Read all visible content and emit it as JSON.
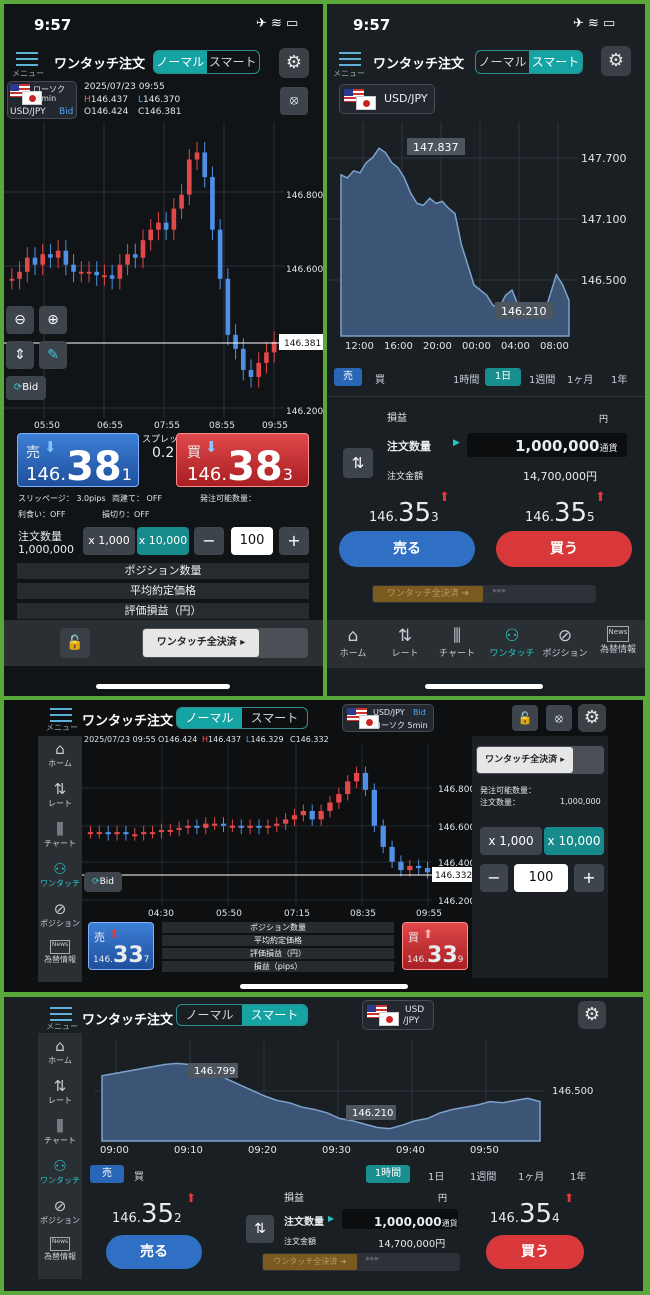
{
  "p1": {
    "time": "9:57",
    "menu_label": "メニュー",
    "title": "ワンタッチ注文",
    "seg_normal": "ノーマル",
    "seg_smart": "スマート",
    "chart_type": "ローソク",
    "interval": "5min",
    "pair": "USD/JPY",
    "side": "Bid",
    "datetime": "2025/07/23 09:55",
    "h_lbl": "H",
    "h_val": "146.437",
    "l_lbl": "L",
    "l_val": "146.370",
    "o_lbl": "O",
    "o_val": "146.424",
    "c_lbl": "C",
    "c_val": "146.381",
    "y_ticks": [
      "146.800",
      "146.600",
      "146.200"
    ],
    "current": "146.381",
    "x_ticks": [
      "05:50",
      "06:55",
      "07:55",
      "08:55",
      "09:55"
    ],
    "bid_btn": "Bid",
    "sell_lbl": "売",
    "buy_lbl": "買",
    "sell_pre": "146.",
    "sell_big": "38",
    "sell_last": "1",
    "buy_pre": "146.",
    "buy_big": "38",
    "buy_last": "3",
    "spread_lbl": "スプレッド",
    "spread_val": "0.2",
    "slip": "スリッページ： 3.0pips",
    "both": "両建て： OFF",
    "avail": "発注可能数量：",
    "take": "利食い：OFF",
    "stop": "損切り：OFF",
    "qty_lbl": "注文数量",
    "qty_val": "1,000,000",
    "x1000": "x 1,000",
    "x10000": "x 10,000",
    "minus": "−",
    "plus": "+",
    "qty_input": "100",
    "rows": [
      "ポジション数量",
      "平均約定価格",
      "評価損益（円）"
    ],
    "settle": "ワンタッチ全決済"
  },
  "p2": {
    "time": "9:57",
    "menu_label": "メニュー",
    "title": "ワンタッチ注文",
    "seg_normal": "ノーマル",
    "seg_smart": "スマート",
    "pair": "USD/JPY",
    "high_lbl": "147.837",
    "low_lbl": "146.210",
    "y_ticks": [
      "147.700",
      "147.100",
      "146.500"
    ],
    "x_ticks": [
      "12:00",
      "16:00",
      "20:00",
      "00:00",
      "04:00",
      "08:00"
    ],
    "sell_tab": "売",
    "buy_tab": "買",
    "tfs": [
      "1時間",
      "1日",
      "1週間",
      "1ヶ月",
      "1年"
    ],
    "pl_lbl": "損益",
    "yen": "円",
    "qty_lbl": "注文数量",
    "qty_val": "1,000,000",
    "qty_unit": "通貨",
    "amount_lbl": "注文金額",
    "amount_val": "14,700,000円",
    "sell_pre": "146.",
    "sell_big": "35",
    "sell_last": "3",
    "buy_pre": "146.",
    "buy_big": "35",
    "buy_last": "5",
    "sell_btn": "売る",
    "buy_btn": "買う",
    "settle": "ワンタッチ全決済",
    "tabs": [
      "ホーム",
      "レート",
      "チャート",
      "ワンタッチ",
      "ポジション",
      "為替情報"
    ],
    "news": "News"
  },
  "p3": {
    "menu_label": "メニュー",
    "title": "ワンタッチ注文",
    "seg_normal": "ノーマル",
    "seg_smart": "スマート",
    "pair": "USD/JPY",
    "side": "Bid",
    "chart_type": "ローソク 5min",
    "datetime": "2025/07/23 09:55",
    "o_lbl": "O",
    "o_val": "146.424",
    "h_lbl": "H",
    "h_val": "146.437",
    "l_lbl": "L",
    "l_val": "146.329",
    "c_lbl": "C",
    "c_val": "146.332",
    "y_ticks": [
      "146.800",
      "146.600",
      "146.400",
      "146.200"
    ],
    "current": "146.332",
    "x_ticks": [
      "04:30",
      "05:50",
      "07:15",
      "08:35",
      "09:55"
    ],
    "bid_btn": "Bid",
    "tabs": [
      "ホーム",
      "レート",
      "チャート",
      "ワンタッチ",
      "ポジション",
      "為替情報"
    ],
    "news": "News",
    "sell_lbl": "売",
    "buy_lbl": "買",
    "sell_pre": "146.",
    "sell_big": "33",
    "sell_last": "7",
    "buy_pre": "146.",
    "buy_big": "33",
    "buy_last": "9",
    "rows": [
      "ポジション数量",
      "平均約定価格",
      "評価損益（円）",
      "損益（pips）"
    ],
    "settle": "ワンタッチ全決済",
    "avail": "発注可能数量：",
    "qty_lbl": "注文数量：",
    "qty_val": "1,000,000",
    "x1000": "x 1,000",
    "x10000": "x 10,000",
    "minus": "−",
    "plus": "+",
    "qty_input": "100",
    "settings": [
      {
        "k": "スリッページ：",
        "v": "3.0pips"
      },
      {
        "k": "両建て：",
        "v": "OFF"
      },
      {
        "k": "利食い：",
        "v": "OFF"
      },
      {
        "k": "損切り：",
        "v": "OFF"
      }
    ]
  },
  "p4": {
    "menu_label": "メニュー",
    "title": "ワンタッチ注文",
    "seg_normal": "ノーマル",
    "seg_smart": "スマート",
    "pair_line1": "USD",
    "pair_line2": "/JPY",
    "high_lbl": "146.799",
    "low_lbl": "146.210",
    "y_tick": "146.500",
    "x_ticks": [
      "09:00",
      "09:10",
      "09:20",
      "09:30",
      "09:40",
      "09:50"
    ],
    "sell_tab": "売",
    "buy_tab": "買",
    "tfs": [
      "1時間",
      "1日",
      "1週間",
      "1ヶ月",
      "1年"
    ],
    "pl_lbl": "損益",
    "yen": "円",
    "qty_lbl": "注文数量",
    "qty_val": "1,000,000",
    "qty_unit": "通貨",
    "amount_lbl": "注文金額",
    "amount_val": "14,700,000円",
    "sell_pre": "146.",
    "sell_big": "35",
    "sell_last": "2",
    "buy_pre": "146.",
    "buy_big": "35",
    "buy_last": "4",
    "sell_btn": "売る",
    "buy_btn": "買う",
    "settle": "ワンタッチ全決済",
    "tabs": [
      "ホーム",
      "レート",
      "チャート",
      "ワンタッチ",
      "ポジション",
      "為替情報"
    ],
    "news": "News"
  },
  "colors": {
    "accent": "#16a3a3",
    "sell": "#2f6fd0",
    "buy": "#d9383a",
    "bg": "#111417"
  },
  "chart_data": [
    {
      "type": "candlestick",
      "series": [
        {
          "name": "USD/JPY",
          "values": [
            146.56,
            146.58,
            146.62,
            146.6,
            146.63,
            146.62,
            146.64,
            146.6,
            146.58,
            146.58,
            146.58,
            146.57,
            146.57,
            146.56,
            146.6,
            146.63,
            146.62,
            146.67,
            146.7,
            146.72,
            146.7,
            146.76,
            146.8,
            146.9,
            146.92,
            146.85,
            146.7,
            146.56,
            146.4,
            146.36,
            146.3,
            146.28,
            146.32,
            146.35,
            146.38
          ]
        }
      ],
      "ylim": [
        146.18,
        146.95
      ]
    },
    {
      "type": "area",
      "series": [
        {
          "name": "USD/JPY",
          "values": [
            147.58,
            147.55,
            147.62,
            147.6,
            147.7,
            147.75,
            147.84,
            147.8,
            147.7,
            147.65,
            147.55,
            147.4,
            147.3,
            147.28,
            147.35,
            147.3,
            147.32,
            147.25,
            147.2,
            146.9,
            146.7,
            146.5,
            146.45,
            146.4,
            146.3,
            146.28,
            146.4,
            146.45,
            146.3,
            146.32,
            146.25,
            146.22,
            146.21,
            146.4,
            146.6,
            146.5,
            146.35
          ]
        }
      ],
      "ylim": [
        146.0,
        148.0
      ]
    },
    {
      "type": "candlestick",
      "series": [
        {
          "name": "USD/JPY",
          "values": [
            146.52,
            146.52,
            146.51,
            146.52,
            146.51,
            146.51,
            146.52,
            146.52,
            146.53,
            146.53,
            146.54,
            146.55,
            146.54,
            146.56,
            146.56,
            146.55,
            146.55,
            146.54,
            146.55,
            146.54,
            146.55,
            146.56,
            146.58,
            146.6,
            146.62,
            146.58,
            146.62,
            146.66,
            146.7,
            146.76,
            146.8,
            146.72,
            146.55,
            146.45,
            146.38,
            146.34,
            146.36,
            146.35,
            146.33
          ]
        }
      ],
      "ylim": [
        146.18,
        146.88
      ]
    },
    {
      "type": "area",
      "series": [
        {
          "name": "USD/JPY",
          "values": [
            146.68,
            146.7,
            146.72,
            146.74,
            146.76,
            146.78,
            146.79,
            146.78,
            146.76,
            146.72,
            146.65,
            146.6,
            146.55,
            146.5,
            146.46,
            146.44,
            146.4,
            146.38,
            146.35,
            146.3,
            146.28,
            146.25,
            146.22,
            146.21,
            146.24,
            146.28,
            146.3,
            146.35,
            146.38,
            146.4,
            146.42,
            146.45,
            146.44,
            146.46,
            146.48,
            146.45
          ]
        }
      ],
      "ylim": [
        146.1,
        146.9
      ]
    }
  ]
}
